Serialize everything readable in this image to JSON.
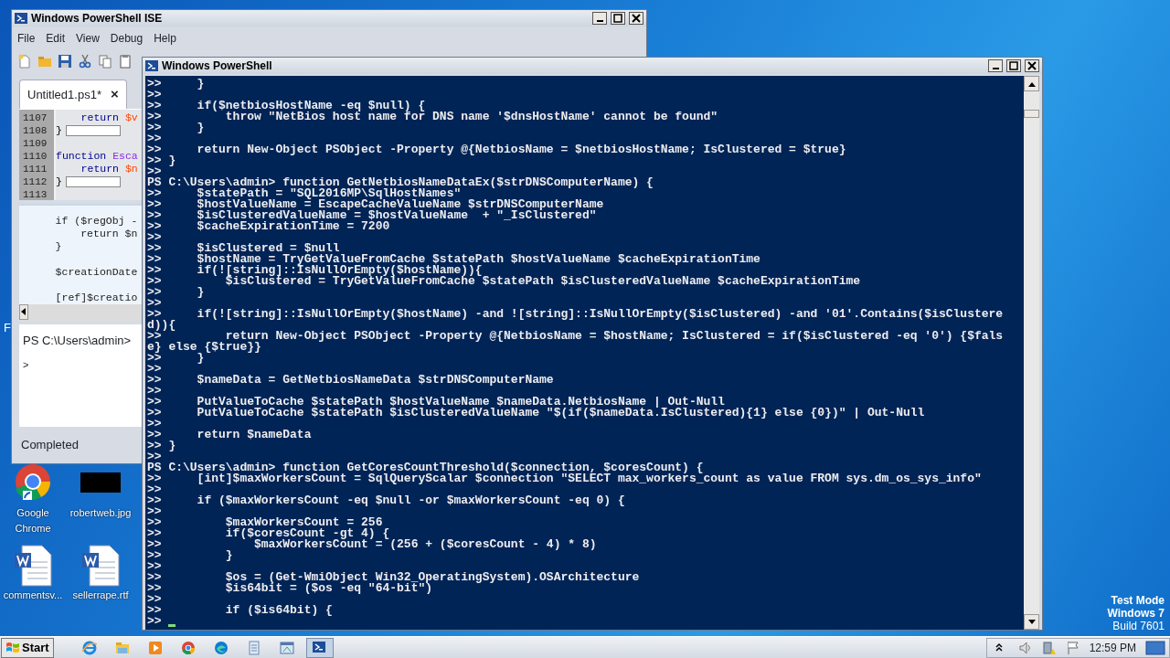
{
  "desktop": {
    "icons": [
      {
        "label": "Google Chrome",
        "kind": "chrome"
      },
      {
        "label": "robertweb.jpg",
        "kind": "image"
      },
      {
        "label": "commentsv...",
        "kind": "word"
      },
      {
        "label": "sellerrape.rtf",
        "kind": "word"
      }
    ],
    "edge_label": "F",
    "os_notice": [
      "Test Mode",
      "Windows 7",
      "Build 7601"
    ]
  },
  "ise_window": {
    "title": "Windows PowerShell ISE",
    "menu": [
      "File",
      "Edit",
      "View",
      "Debug",
      "Help"
    ],
    "tab": {
      "label": "Untitled1.ps1*",
      "selected": true,
      "close": "×"
    },
    "script_lines": [
      {
        "number": "1107",
        "tokens": [
          {
            "text": "    return ",
            "kind": "keyword"
          },
          {
            "text": "$v",
            "kind": "variable"
          }
        ]
      },
      {
        "number": "1108",
        "tokens": [
          {
            "text": "}",
            "kind": "plain"
          }
        ],
        "marker": true
      },
      {
        "number": "1109"
      },
      {
        "number": "1110",
        "tokens": [
          {
            "text": "function ",
            "kind": "keyword"
          },
          {
            "text": "Esca",
            "kind": "name"
          }
        ]
      },
      {
        "number": "1111",
        "tokens": [
          {
            "text": "    return ",
            "kind": "keyword"
          },
          {
            "text": "$n",
            "kind": "variable"
          }
        ]
      },
      {
        "number": "1112",
        "tokens": [
          {
            "text": "}",
            "kind": "plain"
          }
        ],
        "marker": true
      },
      {
        "number": "1113"
      }
    ],
    "tooltip_lines": [
      {
        "text": "    if ($regObj -"
      },
      {
        "text": "        return $n"
      },
      {
        "text": "    }"
      },
      {
        "text": "    $creationDate",
        "gap_before": true
      },
      {
        "text": "    [ref]$creatio",
        "gap_before": true
      }
    ],
    "console_prompt": "PS C:\\Users\\admin>",
    "console_input": ">",
    "status": "Completed"
  },
  "console_window": {
    "title": "Windows PowerShell",
    "lines": [
      ">>     }",
      ">>",
      ">>     if($netbiosHostName -eq $null) {",
      ">>         throw \"NetBios host name for DNS name '$dnsHostName' cannot be found\"",
      ">>     }",
      ">>",
      ">>     return New-Object PSObject -Property @{NetbiosName = $netbiosHostName; IsClustered = $true}",
      ">> }",
      ">>",
      "PS C:\\Users\\admin> function GetNetbiosNameDataEx($strDNSComputerName) {",
      ">>     $statePath = \"SQL2016MP\\SqlHostNames\"",
      ">>     $hostValueName = EscapeCacheValueName $strDNSComputerName",
      ">>     $isClusteredValueName = $hostValueName  + \"_IsClustered\"",
      ">>     $cacheExpirationTime = 7200",
      ">>",
      ">>     $isClustered = $null",
      ">>     $hostName = TryGetValueFromCache $statePath $hostValueName $cacheExpirationTime",
      ">>     if(![string]::IsNullOrEmpty($hostName)){",
      ">>         $isClustered = TryGetValueFromCache $statePath $isClusteredValueName $cacheExpirationTime",
      ">>     }",
      ">>",
      ">>     if(![string]::IsNullOrEmpty($hostName) -and ![string]::IsNullOrEmpty($isClustered) -and '01'.Contains($isClustere",
      "d)){",
      ">>         return New-Object PSObject -Property @{NetbiosName = $hostName; IsClustered = if($isClustered -eq '0') {$fals",
      "e} else {$true}}",
      ">>     }",
      ">>",
      ">>     $nameData = GetNetbiosNameData $strDNSComputerName",
      ">>",
      ">>     PutValueToCache $statePath $hostValueName $nameData.NetbiosName | Out-Null",
      ">>     PutValueToCache $statePath $isClusteredValueName \"$(if($nameData.IsClustered){1} else {0})\" | Out-Null",
      ">>",
      ">>     return $nameData",
      ">> }",
      ">>",
      "PS C:\\Users\\admin> function GetCoresCountThreshold($connection, $coresCount) {",
      ">>     [int]$maxWorkersCount = SqlQueryScalar $connection \"SELECT max_workers_count as value FROM sys.dm_os_sys_info\"",
      ">>",
      ">>     if ($maxWorkersCount -eq $null -or $maxWorkersCount -eq 0) {",
      ">>",
      ">>         $maxWorkersCount = 256",
      ">>         if($coresCount -gt 4) {",
      ">>             $maxWorkersCount = (256 + ($coresCount - 4) * 8)",
      ">>         }",
      ">>",
      ">>         $os = (Get-WmiObject Win32_OperatingSystem).OSArchitecture",
      ">>         $is64bit = ($os -eq \"64-bit\")",
      ">>",
      ">>         if ($is64bit) {",
      ">>"
    ]
  },
  "taskbar": {
    "start": "Start",
    "apps": [
      {
        "kind": "ie",
        "selected": false
      },
      {
        "kind": "folder",
        "selected": false
      },
      {
        "kind": "media",
        "selected": false
      },
      {
        "kind": "chrome",
        "selected": false
      },
      {
        "kind": "edge",
        "selected": false
      },
      {
        "kind": "notepad",
        "selected": false
      },
      {
        "kind": "window",
        "selected": false
      },
      {
        "kind": "powershell",
        "selected": true
      }
    ],
    "clock": "12:59 PM"
  }
}
